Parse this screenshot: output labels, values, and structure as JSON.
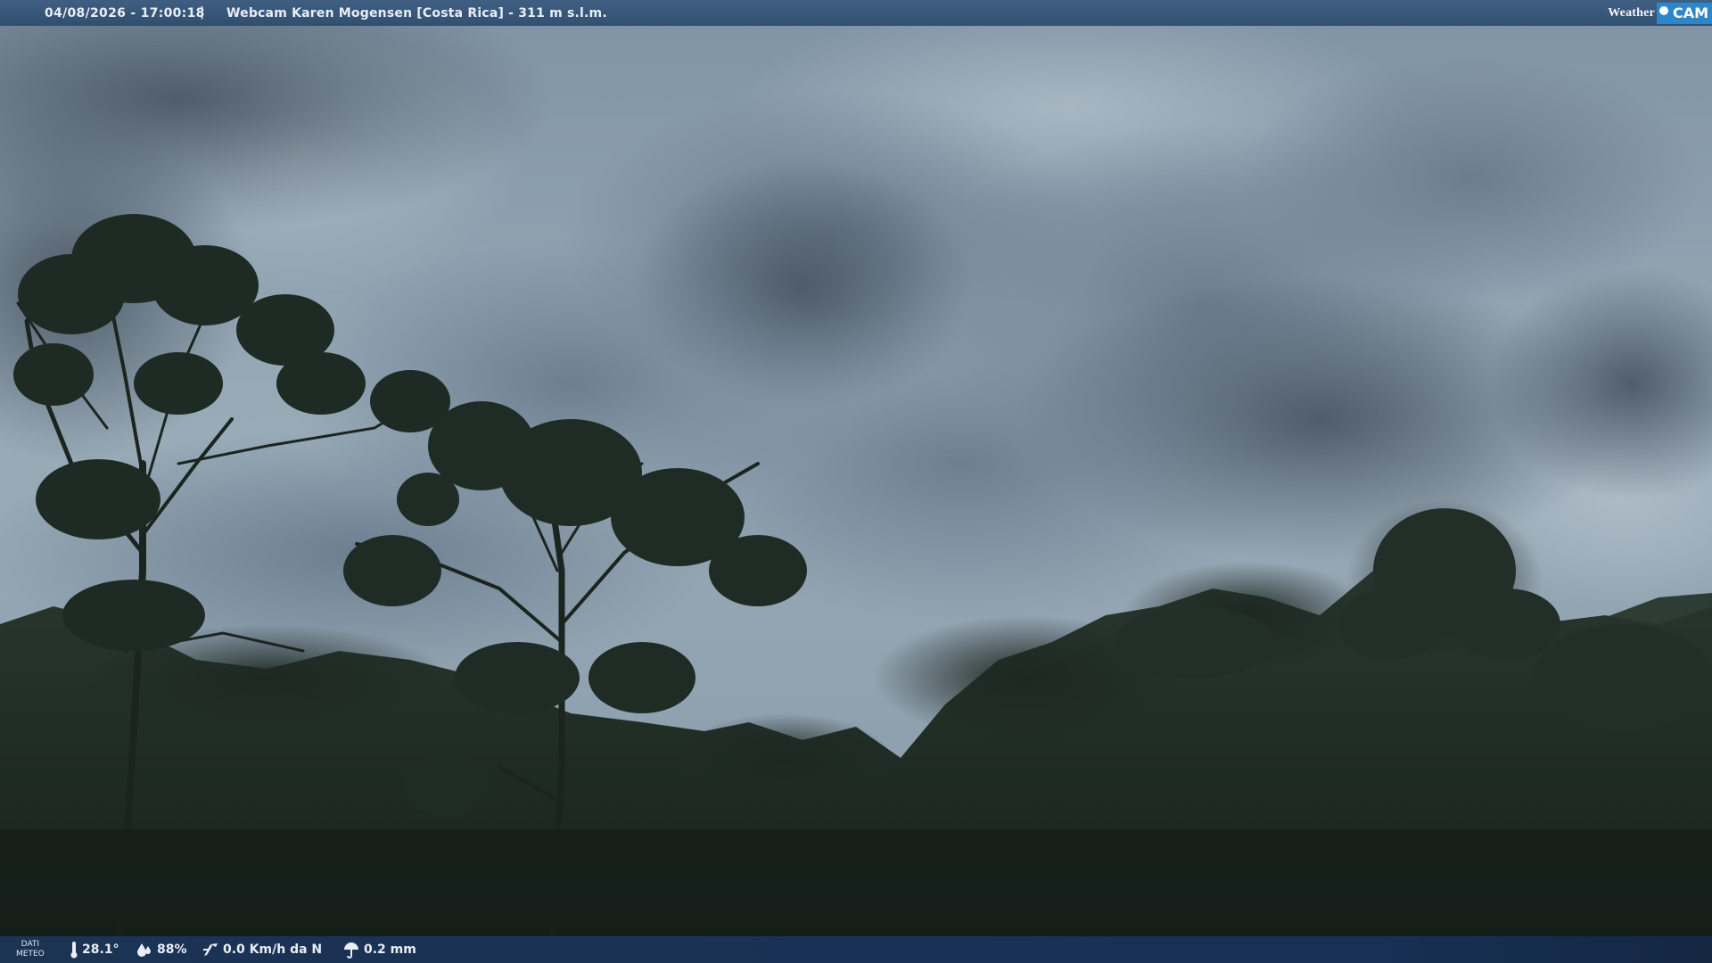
{
  "header": {
    "datetime": "04/08/2026 - 17:00:18",
    "separator": "|",
    "webcam_name": "Webcam Karen Mogensen [Costa Rica]  - 311 m s.l.m.",
    "logo_weather": "Weather",
    "logo_cam": "CAM"
  },
  "footer": {
    "dati_line1": "DATI",
    "dati_line2": "METEO",
    "temperature": "28.1°",
    "temperature_icon": "thermometer-icon",
    "humidity": "88%",
    "humidity_icon": "humidity-icon",
    "wind": "0.0 Km/h da N",
    "wind_icon": "wind-icon",
    "rain": "0.2 mm",
    "rain_icon": "umbrella-icon"
  },
  "colors": {
    "sky": "#8a9caa",
    "cloud_dark": "#4e5c68",
    "forest": "#1f2b24",
    "bar_blue": "#2c4a6c",
    "logo_blue": "#2d86c9"
  }
}
